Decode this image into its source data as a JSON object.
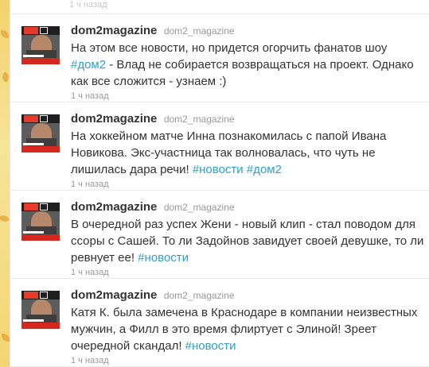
{
  "top_partial_text": "1 ч назад",
  "tweets": [
    {
      "screen_name": "dom2magazine",
      "username": "dom2_magazine",
      "parts": [
        "На этом все новости, но придется огорчить фанатов шоу ",
        "#дом2",
        " - Влад не собирается возвращаться на проект. Однако как все сложится - узнаем :)"
      ],
      "time": "1 ч назад"
    },
    {
      "screen_name": "dom2magazine",
      "username": "dom2_magazine",
      "parts": [
        "На хоккейном матче Инна познакомилась с папой Ивана Новикова. Экс-участница так волновалась, что чуть не лишилась дара речи! ",
        "#новости",
        " ",
        "#дом2"
      ],
      "time": "1 ч назад"
    },
    {
      "screen_name": "dom2magazine",
      "username": "dom2_magazine",
      "parts": [
        "В очередной раз успех Жени - новый клип - стал поводом для ссоры с Сашей. То ли Задойнов завидует своей девушке, то ли ревнует ее! ",
        "#новости"
      ],
      "time": "1 ч назад"
    },
    {
      "screen_name": "dom2magazine",
      "username": "dom2_magazine",
      "parts": [
        "Катя К. была замечена в Краснодаре в компании неизвестных мужчин, а Филл в это время флиртует с Элиной! Зреет очередной скандал! ",
        "#новости"
      ],
      "time": "1 ч назад"
    }
  ],
  "colors": {
    "hashtag": "#2fa0c8",
    "text": "#333333",
    "muted": "#999999",
    "background": "#f6e49a"
  }
}
